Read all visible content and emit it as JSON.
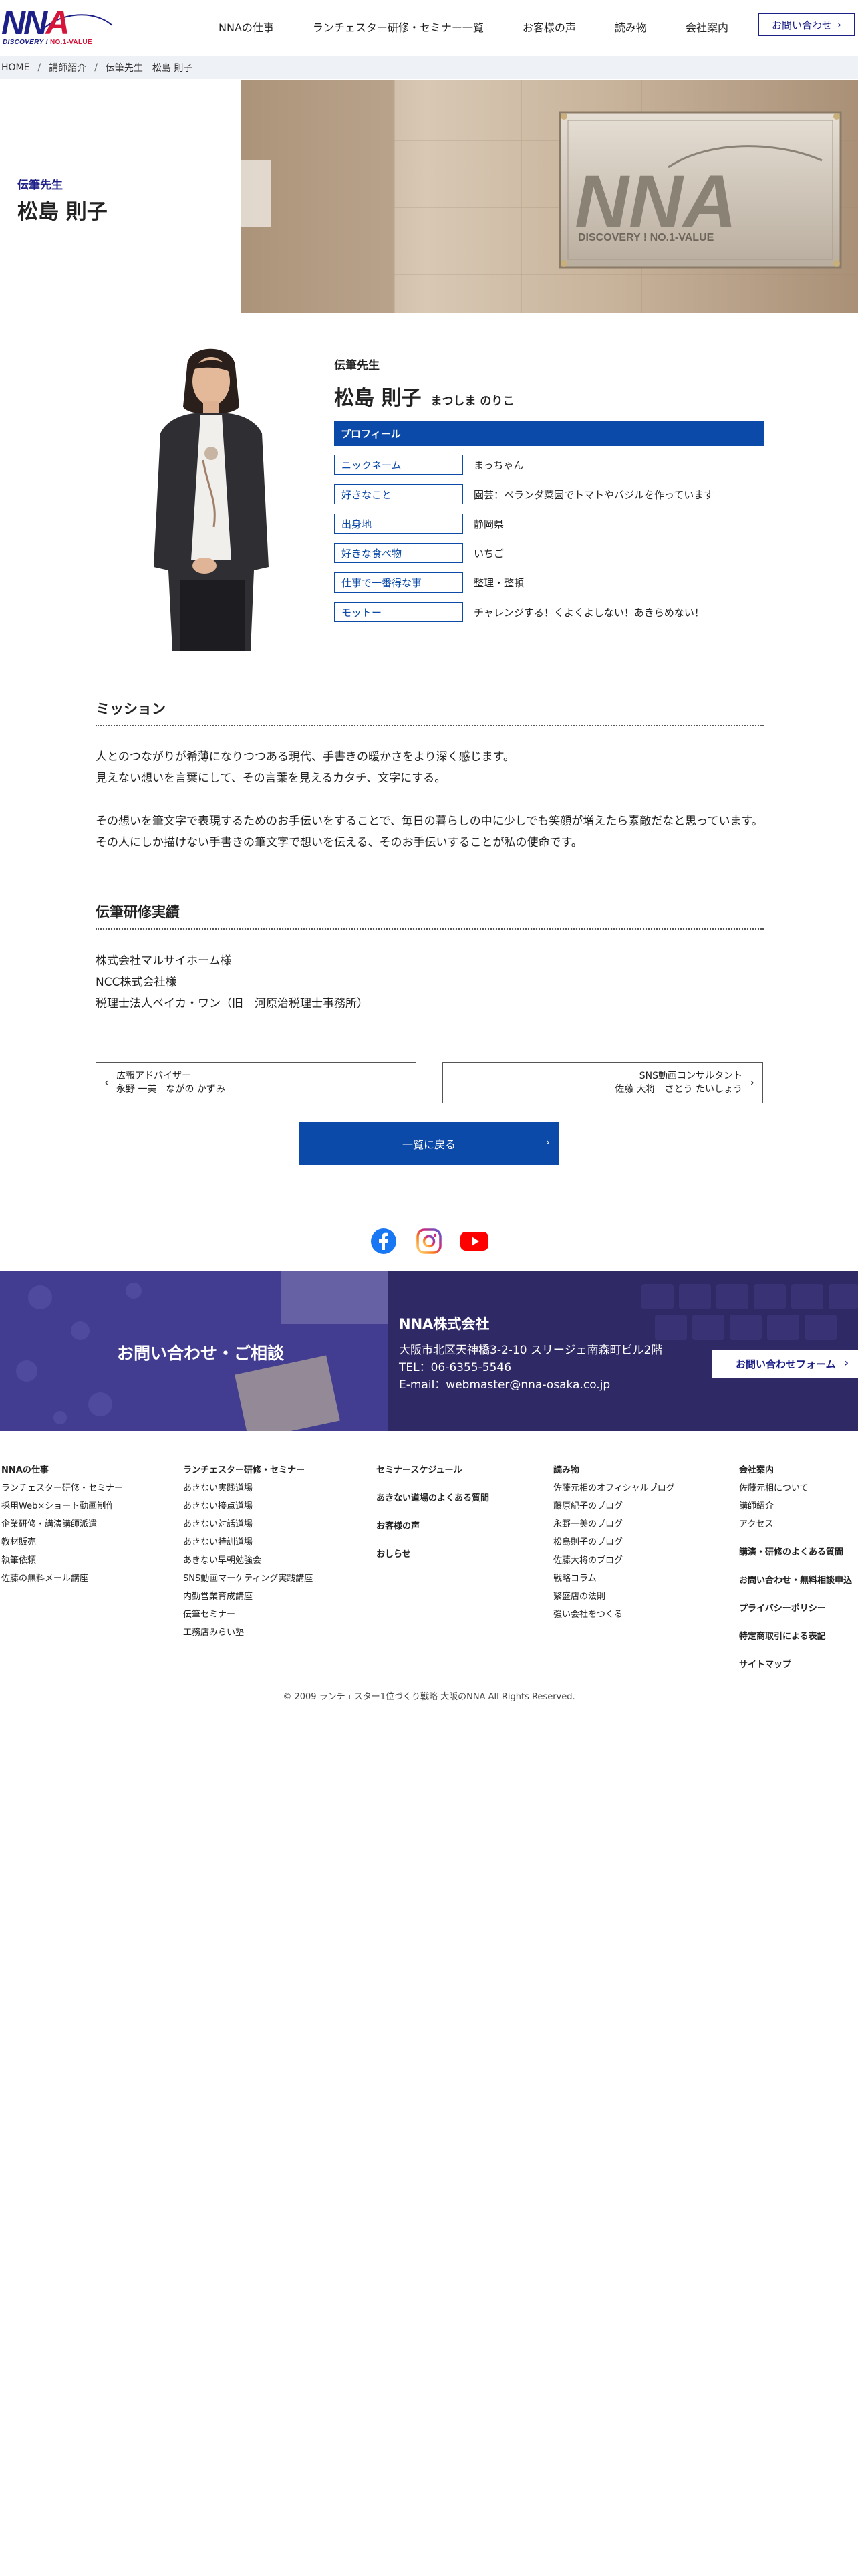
{
  "header": {
    "logo_text_left": "NN",
    "logo_text_right": "A",
    "logo_sub_left": "DISCOVERY ! ",
    "logo_sub_right": "NO.1-VALUE",
    "nav": [
      "NNAの仕事",
      "ランチェスター研修・セミナー一覧",
      "お客様の声",
      "読み物",
      "会社案内"
    ],
    "contact_label": "お問い合わせ"
  },
  "breadcrumb": [
    "HOME",
    "講師紹介",
    "伝筆先生　松島 則子"
  ],
  "hero": {
    "role": "伝筆先生",
    "name": "松島 則子",
    "sign_text": "NNA",
    "sign_sub": "DISCOVERY ! NO.1-VALUE"
  },
  "profile": {
    "role": "伝筆先生",
    "name": "松島 則子",
    "kana": "まつしま のりこ",
    "section_label": "プロフィール",
    "rows": [
      {
        "key": "ニックネーム",
        "value": "まっちゃん"
      },
      {
        "key": "好きなこと",
        "value": "園芸：ベランダ菜園でトマトやバジルを作っています"
      },
      {
        "key": "出身地",
        "value": "静岡県"
      },
      {
        "key": "好きな食べ物",
        "value": "いちご"
      },
      {
        "key": "仕事で一番得な事",
        "value": "整理・整頓"
      },
      {
        "key": "モットー",
        "value": "チャレンジする！くよくよしない！あきらめない！"
      }
    ]
  },
  "mission": {
    "title": "ミッション",
    "lines_1": [
      "人とのつながりが希薄になりつつある現代、手書きの暖かさをより深く感じます。",
      "見えない想いを言葉にして、その言葉を見えるカタチ、文字にする。"
    ],
    "lines_2": [
      "その想いを筆文字で表現するためのお手伝いをすることで、毎日の暮らしの中に少しでも笑顔が増えたら素敵だなと思っています。",
      "その人にしか描けない手書きの筆文字で想いを伝える、そのお手伝いすることが私の使命です。"
    ]
  },
  "achievements": {
    "title": "伝筆研修実績",
    "items": [
      "株式会社マルサイホーム様",
      "NCC株式会社様",
      "税理士法人ベイカ・ワン（旧　河原治税理士事務所）"
    ]
  },
  "pager": {
    "prev_role": "広報アドバイザー",
    "prev_name": "永野 一美　ながの かずみ",
    "next_role": "SNS動画コンサルタント",
    "next_name": "佐藤 大将　さとう たいしょう",
    "back_label": "一覧に戻る"
  },
  "social": [
    "facebook-icon",
    "instagram-icon",
    "youtube-icon"
  ],
  "contact_band": {
    "title": "お問い合わせ・ご相談",
    "company": "NNA株式会社",
    "address": "大阪市北区天神橋3-2-10 スリージェ南森町ビル2階",
    "tel": "TEL：06-6355-5546",
    "email": "E-mail：webmaster@nna-osaka.co.jp",
    "form_label": "お問い合わせフォーム"
  },
  "footer": {
    "col1": {
      "head": "NNAの仕事",
      "items": [
        "ランチェスター研修・セミナー",
        "採用Web×ショート動画制作",
        "企業研修・講演講師派遣",
        "教材販売",
        "執筆依頼",
        "佐藤の無料メール講座"
      ]
    },
    "col2": {
      "head": "ランチェスター研修・セミナー",
      "items": [
        "あきない実践道場",
        "あきない接点道場",
        "あきない対話道場",
        "あきない特訓道場",
        "あきない早朝勉強会",
        "SNS動画マーケティング実践講座",
        "内勤営業育成講座",
        "伝筆セミナー",
        "工務店みらい塾"
      ]
    },
    "col3": {
      "items": [
        "セミナースケジュール",
        "あきない道場のよくある質問",
        "お客様の声",
        "おしらせ"
      ]
    },
    "col4": {
      "head": "読み物",
      "items": [
        "佐藤元相のオフィシャルブログ",
        "藤原紀子のブログ",
        "永野一美のブログ",
        "松島則子のブログ",
        "佐藤大将のブログ",
        "戦略コラム",
        "繁盛店の法則",
        "強い会社をつくる"
      ]
    },
    "col5": {
      "head": "会社案内",
      "items": [
        "佐藤元相について",
        "講師紹介",
        "アクセス"
      ],
      "bold": [
        "講演・研修のよくある質問",
        "お問い合わせ・無料相談申込",
        "プライバシーポリシー",
        "特定商取引による表記",
        "サイトマップ"
      ]
    }
  },
  "copyright": "© 2009 ランチェスター1位づくり戦略 大阪のNNA All Rights Reserved.",
  "colors": {
    "brand_blue": "#0b4aa8",
    "brand_navy": "#1d2088",
    "brand_red": "#d6153a"
  }
}
